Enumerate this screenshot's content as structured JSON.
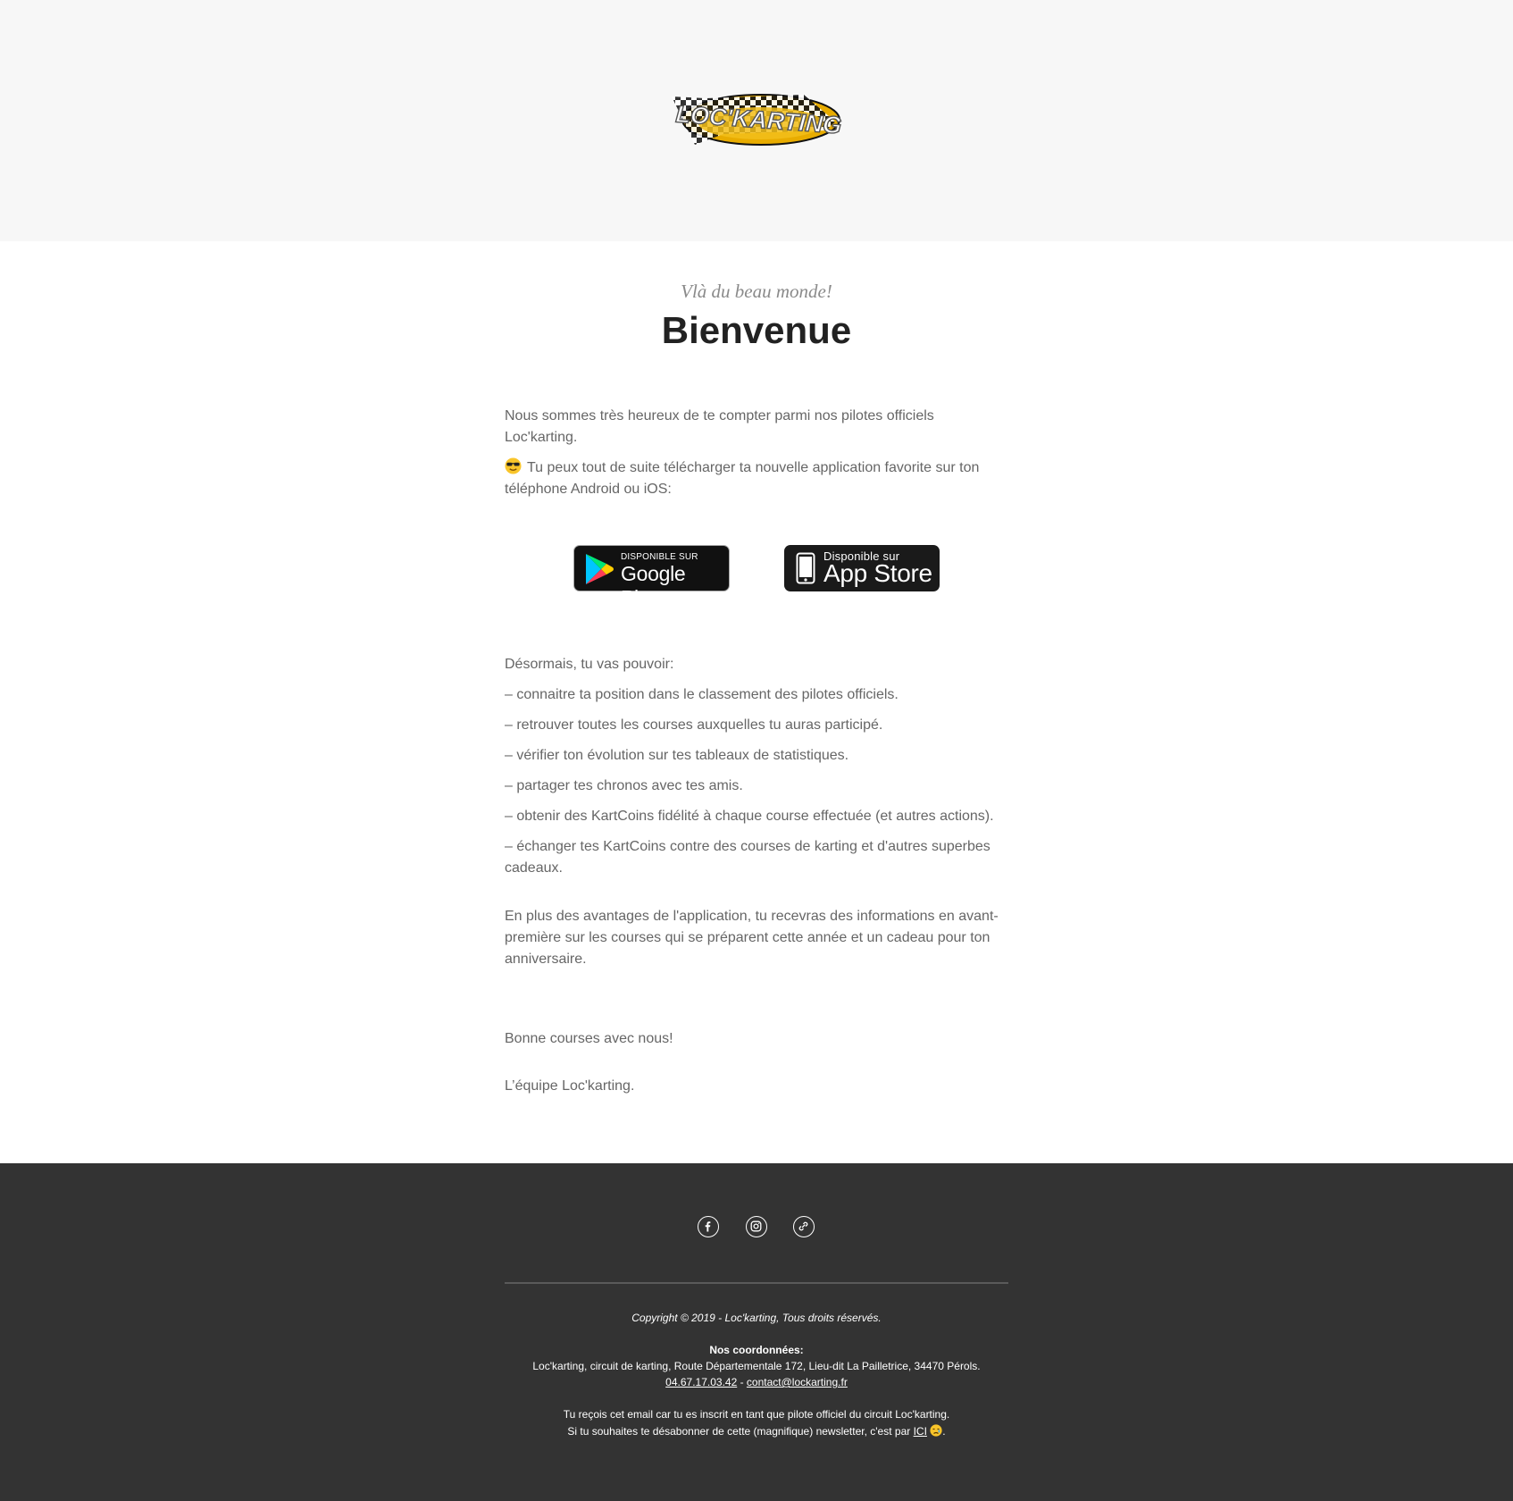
{
  "header": {
    "logo_name": "Loc'karting logo"
  },
  "hero": {
    "preheading": "Vlà du beau monde!",
    "title": "Bienvenue"
  },
  "intro": {
    "paragraph1": "Nous sommes très heureux de te compter parmi nos pilotes officiels Loc'karting.",
    "paragraph2_emoji": "smiling-face-with-sunglasses",
    "paragraph2": "Tu peux tout de suite télécharger ta nouvelle application favorite sur ton téléphone Android ou iOS:"
  },
  "stores": {
    "google_play": {
      "small": "DISPONIBLE SUR",
      "big": "Google Play"
    },
    "app_store": {
      "small": "Disponible sur",
      "big": "App Store"
    }
  },
  "features": {
    "intro": "Désormais, tu vas pouvoir:",
    "items": [
      "– connaitre ta position dans le classement des pilotes officiels.",
      "– retrouver toutes les courses auxquelles tu auras participé.",
      "– vérifier ton évolution sur tes tableaux de statistiques.",
      "– partager tes chronos avec tes amis.",
      "– obtenir des KartCoins fidélité à chaque course effectuée (et autres actions).",
      "– échanger tes KartCoins contre des courses de karting et d'autres superbes cadeaux."
    ]
  },
  "extra": {
    "paragraph": "En plus des avantages de l'application, tu recevras des informations en avant-première sur les courses qui se préparent cette année et un cadeau pour ton anniversaire."
  },
  "closing": {
    "line1": "Bonne courses avec nous!",
    "line2": "L’équipe Loc'karting."
  },
  "footer": {
    "social": [
      "facebook-icon",
      "instagram-icon",
      "link-icon"
    ],
    "copyright": "Copyright © 2019 - Loc'karting, Tous droits réservés.",
    "contact_heading": "Nos coordonnées:",
    "address": "Loc'karting, circuit de karting, Route Départementale 172, Lieu-dit La Pailletrice, 34470 Pérols.",
    "phone": "04.67.17.03.42",
    "separator": " - ",
    "email": "contact@lockarting.fr",
    "notice1": "Tu reçois cet email car tu es inscrit en tant que pilote officiel du circuit Loc'karting.",
    "notice2_prefix": "Si tu souhaites te désabonner de cette (magnifique) newsletter, c'est par ",
    "unsubscribe_link": "ICI",
    "notice2_suffix": "."
  },
  "colors": {
    "header_bg": "#f7f7f7",
    "footer_bg": "#333333",
    "title": "#222222",
    "text": "#666666",
    "logo_yellow": "#f0b400"
  }
}
